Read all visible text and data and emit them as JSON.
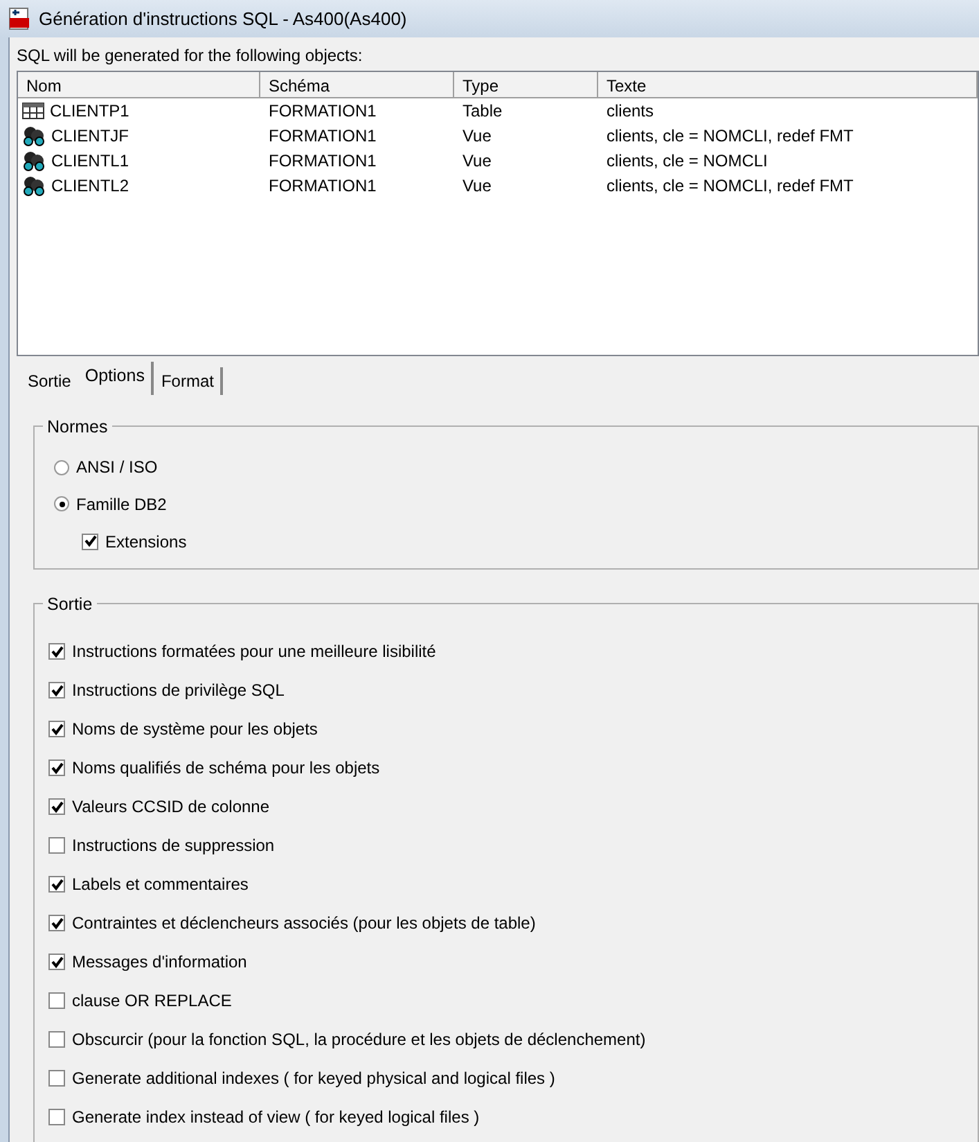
{
  "window": {
    "title": "Génération d'instructions SQL - As400(As400)"
  },
  "intro": "SQL will be generated for the following objects:",
  "table": {
    "columns": [
      "Nom",
      "Schéma",
      "Type",
      "Texte"
    ],
    "rows": [
      {
        "kind": "table",
        "cells": [
          "CLIENTP1",
          "FORMATION1",
          "Table",
          "clients"
        ]
      },
      {
        "kind": "view",
        "cells": [
          "CLIENTJF",
          "FORMATION1",
          "Vue",
          "clients, cle = NOMCLI, redef FMT"
        ]
      },
      {
        "kind": "view",
        "cells": [
          "CLIENTL1",
          "FORMATION1",
          "Vue",
          "clients, cle = NOMCLI"
        ]
      },
      {
        "kind": "view",
        "cells": [
          "CLIENTL2",
          "FORMATION1",
          "Vue",
          "clients, cle = NOMCLI, redef FMT"
        ]
      }
    ]
  },
  "tabs": [
    {
      "label": "Sortie",
      "selected": false
    },
    {
      "label": "Options",
      "selected": true
    },
    {
      "label": "Format",
      "selected": false
    }
  ],
  "normes": {
    "title": "Normes",
    "options": [
      {
        "kind": "radio",
        "label": "ANSI / ISO",
        "checked": false
      },
      {
        "kind": "radio",
        "label": "Famille DB2",
        "checked": true
      },
      {
        "kind": "checkbox",
        "label": "Extensions",
        "checked": true
      }
    ]
  },
  "sortie": {
    "title": "Sortie",
    "options": [
      {
        "label": "Instructions formatées pour une meilleure lisibilité",
        "checked": true
      },
      {
        "label": "Instructions de privilège SQL",
        "checked": true
      },
      {
        "label": "Noms de système pour les objets",
        "checked": true
      },
      {
        "label": "Noms qualifiés de schéma pour les objets",
        "checked": true
      },
      {
        "label": "Valeurs CCSID de colonne",
        "checked": true
      },
      {
        "label": "Instructions de suppression",
        "checked": false
      },
      {
        "label": "Labels et commentaires",
        "checked": true
      },
      {
        "label": "Contraintes et déclencheurs associés (pour les objets de table)",
        "checked": true
      },
      {
        "label": "Messages d'information",
        "checked": true
      },
      {
        "label": "clause OR REPLACE",
        "checked": false
      },
      {
        "label": "Obscurcir (pour la fonction SQL, la procédure et les objets de déclenchement)",
        "checked": false
      },
      {
        "label": "Generate additional indexes ( for keyed physical and logical files )",
        "checked": false
      },
      {
        "label": "Generate index instead of view ( for keyed logical files )",
        "checked": false
      }
    ]
  }
}
